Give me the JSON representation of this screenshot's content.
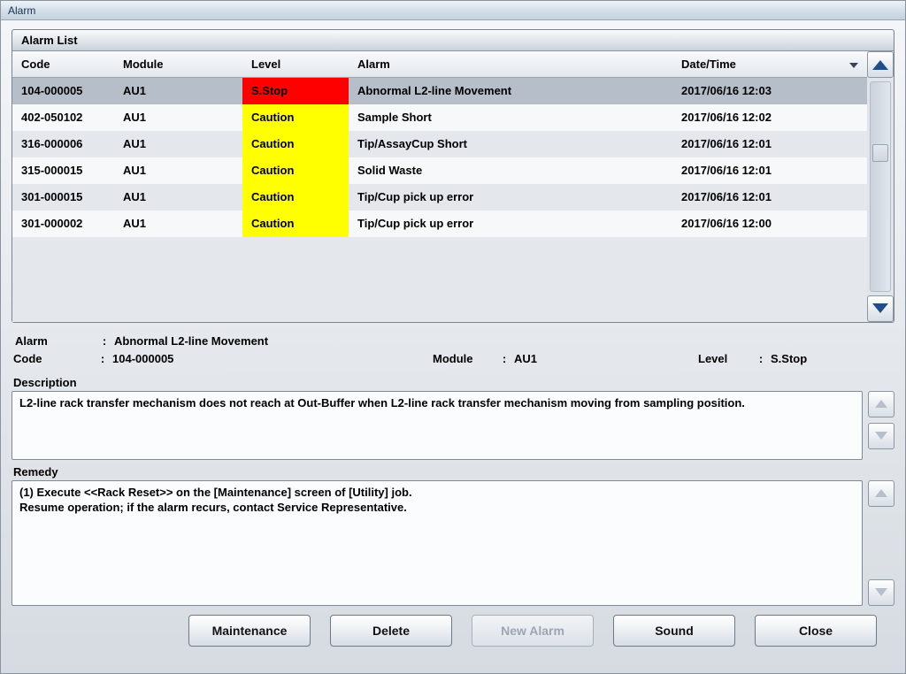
{
  "window": {
    "title": "Alarm"
  },
  "list": {
    "header": "Alarm List",
    "columns": {
      "code": "Code",
      "module": "Module",
      "level": "Level",
      "alarm": "Alarm",
      "datetime": "Date/Time"
    },
    "rows": [
      {
        "code": "104-000005",
        "module": "AU1",
        "level": "S.Stop",
        "level_class": "sstop",
        "alarm": "Abnormal L2-line Movement",
        "datetime": "2017/06/16 12:03",
        "selected": true
      },
      {
        "code": "402-050102",
        "module": "AU1",
        "level": "Caution",
        "level_class": "caution",
        "alarm": "Sample Short",
        "datetime": "2017/06/16 12:02"
      },
      {
        "code": "316-000006",
        "module": "AU1",
        "level": "Caution",
        "level_class": "caution",
        "alarm": "Tip/AssayCup Short",
        "datetime": "2017/06/16 12:01"
      },
      {
        "code": "315-000015",
        "module": "AU1",
        "level": "Caution",
        "level_class": "caution",
        "alarm": "Solid Waste",
        "datetime": "2017/06/16 12:01"
      },
      {
        "code": "301-000015",
        "module": "AU1",
        "level": "Caution",
        "level_class": "caution",
        "alarm": "Tip/Cup pick up error",
        "datetime": "2017/06/16 12:01"
      },
      {
        "code": "301-000002",
        "module": "AU1",
        "level": "Caution",
        "level_class": "caution",
        "alarm": "Tip/Cup pick up error",
        "datetime": "2017/06/16 12:00"
      }
    ]
  },
  "detail": {
    "labels": {
      "alarm": "Alarm",
      "code": "Code",
      "module": "Module",
      "level": "Level",
      "description": "Description",
      "remedy": "Remedy",
      "colon": ":"
    },
    "alarm": "Abnormal L2-line Movement",
    "code": "104-000005",
    "module": "AU1",
    "level": "S.Stop",
    "description": "L2-line rack transfer mechanism does not reach at Out-Buffer when L2-line rack transfer mechanism moving from sampling position.",
    "remedy": "(1) Execute <<Rack Reset>> on the [Maintenance] screen of [Utility] job.\nResume operation; if the alarm recurs, contact Service Representative."
  },
  "buttons": {
    "maintenance": "Maintenance",
    "delete": "Delete",
    "new_alarm": "New Alarm",
    "sound": "Sound",
    "close": "Close"
  },
  "colors": {
    "sstop": "#ff0000",
    "caution": "#ffff00"
  }
}
